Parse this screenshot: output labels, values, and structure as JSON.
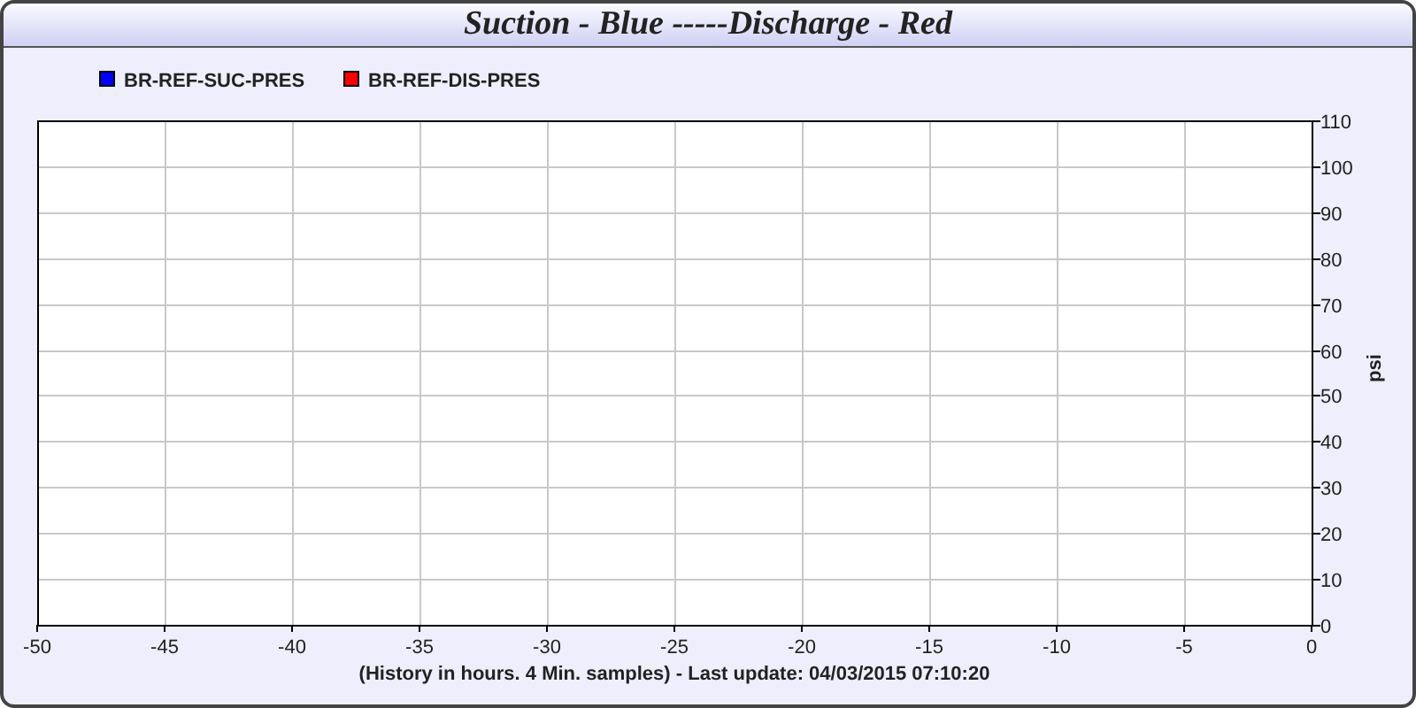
{
  "window": {
    "title": "Suction - Blue -----Discharge - Red"
  },
  "chart": {
    "chart_data": {
      "type": "line",
      "xlabel": "(History in hours. 4 Min. samples) - Last update: 04/03/2015 07:10:20",
      "ylabel": "psi",
      "series": [
        {
          "name": "BR-REF-SUC-PRES",
          "color": "#0000ff",
          "values": [
            null,
            null,
            null,
            null,
            null,
            null,
            null,
            null,
            null,
            null,
            null
          ]
        },
        {
          "name": "BR-REF-DIS-PRES",
          "color": "#ff0000",
          "values": [
            null,
            null,
            null,
            null,
            null,
            null,
            null,
            null,
            null,
            null,
            null
          ]
        }
      ],
      "categories": [
        "-50",
        "-45",
        "-40",
        "-35",
        "-30",
        "-25",
        "-20",
        "-15",
        "-10",
        "-5",
        "0"
      ],
      "ylim": [
        0,
        110
      ],
      "grid": true,
      "yticks": [
        0,
        10,
        20,
        30,
        40,
        50,
        60,
        70,
        80,
        90,
        100,
        110
      ]
    }
  }
}
